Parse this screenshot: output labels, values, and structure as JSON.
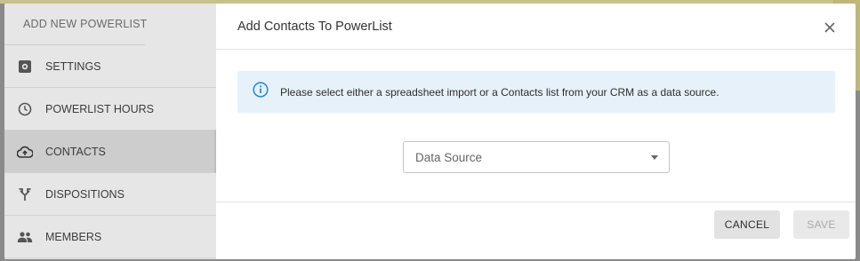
{
  "sidebar": {
    "header": "ADD NEW POWERLIST",
    "items": [
      {
        "label": "SETTINGS",
        "icon": "gear-icon"
      },
      {
        "label": "POWERLIST HOURS",
        "icon": "clock-icon"
      },
      {
        "label": "CONTACTS",
        "icon": "cloud-upload-icon",
        "active": true
      },
      {
        "label": "DISPOSITIONS",
        "icon": "split-arrows-icon"
      },
      {
        "label": "MEMBERS",
        "icon": "people-icon"
      }
    ]
  },
  "dialog": {
    "title": "Add Contacts To PowerList",
    "info": "Please select either a spreadsheet import or a Contacts list from your CRM as a data source.",
    "data_source_placeholder": "Data Source",
    "cancel_label": "CANCEL",
    "save_label": "SAVE"
  },
  "colors": {
    "info_bg": "#e6f1fa",
    "info_icon": "#2a8ad8",
    "sidebar_bg": "#e6e6e6",
    "active_item_bg": "#cdcdcd"
  }
}
